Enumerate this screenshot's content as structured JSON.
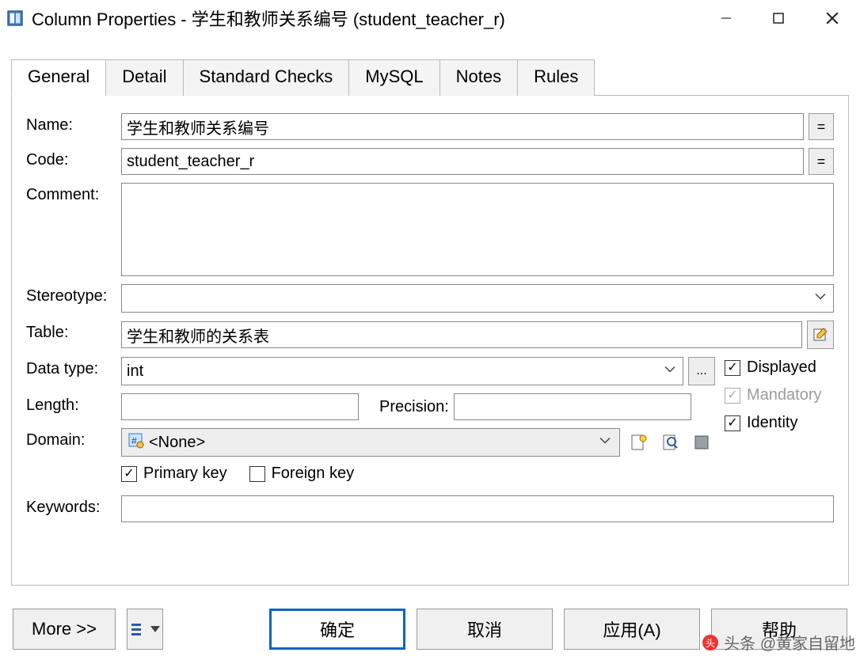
{
  "window": {
    "title": "Column Properties - 学生和教师关系编号 (student_teacher_r)"
  },
  "tabs": [
    "General",
    "Detail",
    "Standard Checks",
    "MySQL",
    "Notes",
    "Rules"
  ],
  "labels": {
    "name": "Name:",
    "code": "Code:",
    "comment": "Comment:",
    "stereotype": "Stereotype:",
    "table": "Table:",
    "datatype": "Data type:",
    "length": "Length:",
    "precision": "Precision:",
    "domain": "Domain:",
    "keywords": "Keywords:"
  },
  "values": {
    "name": "学生和教师关系编号",
    "code": "student_teacher_r",
    "comment": "",
    "stereotype": "",
    "table": "学生和教师的关系表",
    "datatype": "int",
    "length": "",
    "precision": "",
    "domain": "<None>",
    "keywords": ""
  },
  "checks": {
    "displayed_label": "Displayed",
    "displayed": true,
    "mandatory_label": "Mandatory",
    "mandatory": true,
    "identity_label": "Identity",
    "identity": true,
    "primary_label": "Primary key",
    "primary": true,
    "foreign_label": "Foreign key",
    "foreign": false
  },
  "buttons": {
    "more": "More >>",
    "ok": "确定",
    "cancel": "取消",
    "apply": "应用(A)",
    "help": "帮助",
    "equals": "=",
    "ellipsis": "..."
  },
  "watermark": "头条 @黄家自留地"
}
